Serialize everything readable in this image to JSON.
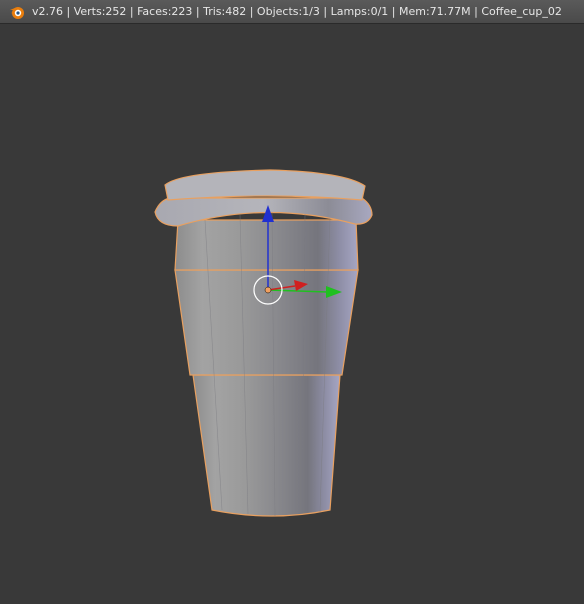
{
  "app": {
    "logo_icon": "blender-logo-icon"
  },
  "info_header": {
    "stats_text": "v2.76 | Verts:252 | Faces:223 | Tris:482 | Objects:1/3 | Lamps:0/1 | Mem:71.77M | Coffee_cup_02"
  },
  "viewport": {
    "background_color": "#393939",
    "object": {
      "selection_outline_color": "#f0a050",
      "base_color": "#9a9aa0"
    },
    "gizmo": {
      "x_axis_color": "#d02020",
      "y_axis_color": "#20c020",
      "z_axis_color": "#2030d0"
    }
  }
}
